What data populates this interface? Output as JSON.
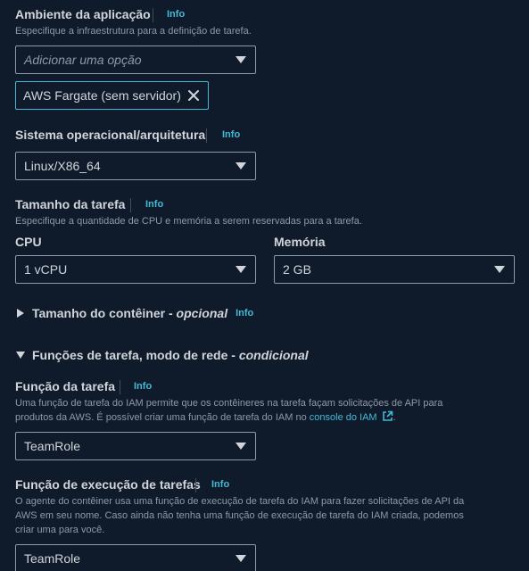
{
  "ambiente": {
    "label": "Ambiente da aplicação",
    "info": "Info",
    "description": "Especifique a infraestrutura para a definição de tarefa.",
    "placeholder": "Adicionar uma opção",
    "token": "AWS Fargate (sem servidor)"
  },
  "sistema": {
    "label": "Sistema operacional/arquitetura",
    "info": "Info",
    "value": "Linux/X86_64"
  },
  "tamanho": {
    "label": "Tamanho da tarefa",
    "info": "Info",
    "description": "Especifique a quantidade de CPU e memória a serem reservadas para a tarefa.",
    "cpu_label": "CPU",
    "cpu_value": "1 vCPU",
    "memoria_label": "Memória",
    "memoria_value": "2 GB"
  },
  "container": {
    "title": "Tamanho do contêiner - ",
    "suffix": "opcional",
    "info": "Info"
  },
  "funcoes": {
    "title": "Funções de tarefa, modo de rede - ",
    "suffix": "condicional"
  },
  "funcao_tarefa": {
    "label": "Função da tarefa",
    "info": "Info",
    "description_line1": "Uma função de tarefa do IAM permite que os contêineres na tarefa façam solicitações de API para",
    "description_line2": "produtos da AWS. É possível criar uma função de tarefa do IAM no ",
    "link": "console do IAM",
    "link_end": ".",
    "value": "TeamRole"
  },
  "funcao_execucao": {
    "label": "Função de execução de tarefas",
    "info": "Info",
    "description_line1": "O agente do contêiner usa uma função de execução de tarefa do IAM para fazer solicitações de API da",
    "description_line2": "AWS em seu nome. Caso ainda não tenha uma função de execução de tarefa do IAM criada, podemos",
    "description_line3": "criar uma para você.",
    "value": "TeamRole"
  }
}
